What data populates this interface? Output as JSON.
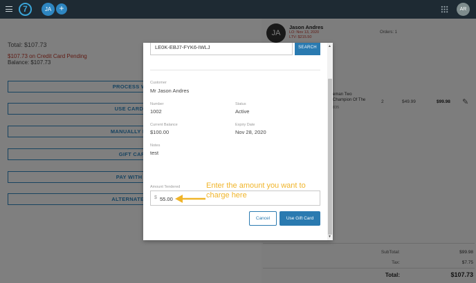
{
  "topbar": {
    "logo": "7",
    "user_initials": "JA",
    "add_label": "+",
    "right_initials": "AR"
  },
  "left_panel": {
    "total": "Total: $107.73",
    "pending": "$107.73 on Credit Card Pending",
    "balance": "Balance: $107.73",
    "buttons": [
      "PROCESS WITH",
      "USE CARD ON",
      "MANUALLY ENTE",
      "GIFT CARD",
      "PAY WITH CA",
      "ALTERNATE PAY"
    ]
  },
  "customer_panel": {
    "avatar": "JA",
    "name": "Jason Andres",
    "last_order": "LO: Nov 13, 2020",
    "ltv": "LTV: $215.50",
    "orders": "Orders: 1",
    "item": {
      "name_line1": "eman Two",
      "name_line2": "Champion Of The",
      "sku": "835",
      "qty": "2",
      "price": "$49.99",
      "total": "$99.98"
    },
    "summary": {
      "subtotal_label": "SubTotal:",
      "subtotal_value": "$99.98",
      "tax_label": "Tax:",
      "tax_value": "$7.75",
      "total_label": "Total:",
      "total_value": "$107.73"
    }
  },
  "modal": {
    "gift_card_number": "LE0K-EBJ7-FYK6-IWLJ",
    "search_label": "SEARCH",
    "customer_label": "Customer",
    "customer_value": "Mr Jason Andres",
    "number_label": "Number",
    "number_value": "1002",
    "status_label": "Status",
    "status_value": "Active",
    "balance_label": "Current Balance",
    "balance_value": "$100.00",
    "expiry_label": "Expiry Date",
    "expiry_value": "Nov 28, 2020",
    "notes_label": "Notes",
    "notes_value": "test",
    "amount_label": "Amount Tendered",
    "currency_symbol": "$",
    "amount_value": "55.00",
    "cancel_label": "Cancel",
    "use_label": "Use Gift Card",
    "annotation": "Enter the amount you want to charge here"
  },
  "colors": {
    "accent": "#2a7ab0",
    "annotation": "#f0b429",
    "pending": "#c0392b",
    "topbar": "#1e2a33"
  }
}
